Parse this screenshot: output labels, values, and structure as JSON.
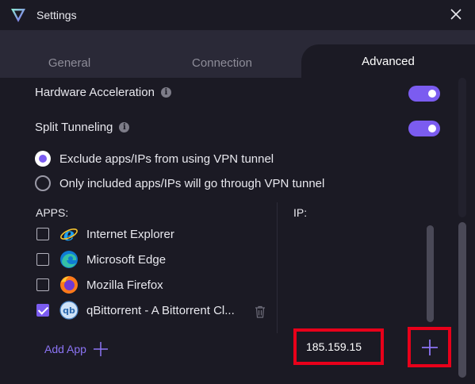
{
  "window": {
    "title": "Settings"
  },
  "tabs": [
    {
      "label": "General"
    },
    {
      "label": "Connection"
    },
    {
      "label": "Advanced"
    }
  ],
  "settings": {
    "hardware_acceleration": {
      "label": "Hardware Acceleration",
      "enabled": true
    },
    "split_tunneling": {
      "label": "Split Tunneling",
      "enabled": true
    }
  },
  "tunnel_mode": {
    "options": [
      {
        "label": "Exclude apps/IPs from using VPN tunnel",
        "selected": true
      },
      {
        "label": "Only included apps/IPs will go through VPN tunnel",
        "selected": false
      }
    ]
  },
  "apps": {
    "header": "APPS:",
    "items": [
      {
        "name": "Internet Explorer",
        "checked": false,
        "icon": "internet-explorer-icon"
      },
      {
        "name": "Microsoft Edge",
        "checked": false,
        "icon": "microsoft-edge-icon"
      },
      {
        "name": "Mozilla Firefox",
        "checked": false,
        "icon": "firefox-icon"
      },
      {
        "name": "qBittorrent - A Bittorrent Cl...",
        "checked": true,
        "icon": "qbittorrent-icon"
      }
    ],
    "add_label": "Add App"
  },
  "ip": {
    "header": "IP:",
    "input_value": "185.159.15"
  },
  "colors": {
    "accent": "#7b5cf0",
    "background": "#1b1a24",
    "tabbar": "#2a2937",
    "highlight": "#e8001a"
  }
}
